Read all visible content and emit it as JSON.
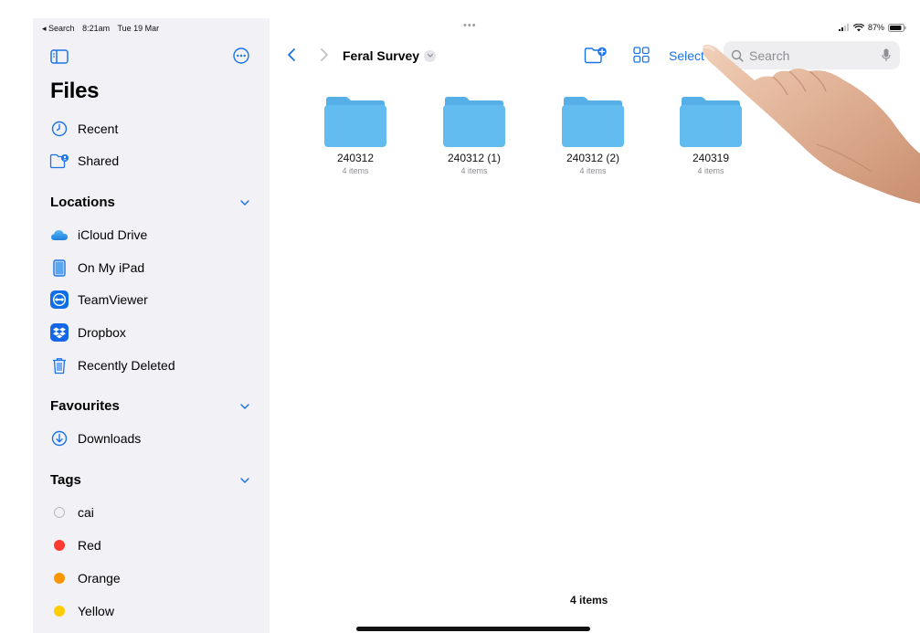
{
  "status_bar": {
    "back_app": "◂ Search",
    "time": "8:21am",
    "date": "Tue 19 Mar",
    "battery": "87%"
  },
  "sidebar": {
    "title": "Files",
    "top_items": [
      {
        "label": "Recent",
        "icon": "clock-icon"
      },
      {
        "label": "Shared",
        "icon": "shared-folder-icon"
      }
    ],
    "sections": {
      "locations": {
        "title": "Locations",
        "items": [
          {
            "label": "iCloud Drive",
            "icon": "icloud-icon"
          },
          {
            "label": "On My iPad",
            "icon": "ipad-icon"
          },
          {
            "label": "TeamViewer",
            "icon": "teamviewer-icon"
          },
          {
            "label": "Dropbox",
            "icon": "dropbox-icon"
          },
          {
            "label": "Recently Deleted",
            "icon": "trash-icon"
          }
        ]
      },
      "favourites": {
        "title": "Favourites",
        "items": [
          {
            "label": "Downloads",
            "icon": "download-circle-icon"
          }
        ]
      },
      "tags": {
        "title": "Tags",
        "items": [
          {
            "label": "cai",
            "color": ""
          },
          {
            "label": "Red",
            "color": "#ff3b30"
          },
          {
            "label": "Orange",
            "color": "#ff9500"
          },
          {
            "label": "Yellow",
            "color": "#ffcc00"
          }
        ]
      }
    }
  },
  "toolbar": {
    "folder_title": "Feral Survey",
    "select_label": "Select",
    "search_placeholder": "Search"
  },
  "folders": [
    {
      "name": "240312",
      "count": "4 items"
    },
    {
      "name": "240312 (1)",
      "count": "4 items"
    },
    {
      "name": "240312 (2)",
      "count": "4 items"
    },
    {
      "name": "240319",
      "count": "4 items"
    }
  ],
  "footer": {
    "item_count": "4 items"
  },
  "colors": {
    "accent": "#1a73e8",
    "folder": "#5ab4ea",
    "sidebar_bg": "#f2f2f6"
  }
}
